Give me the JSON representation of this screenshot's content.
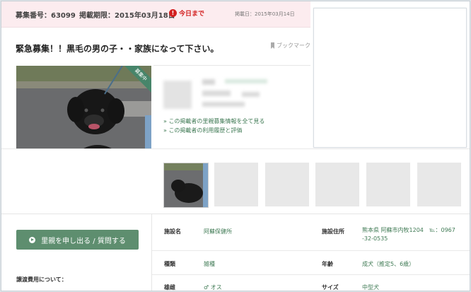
{
  "header": {
    "recruit_no_label": "募集番号：63099",
    "deadline_label": "掲載期限：2015年03月18日",
    "today_badge_icon": "alert-circle-icon",
    "today_badge": "今日まで",
    "posted_date": "掲載日：2015年03月14日"
  },
  "listing": {
    "title": "緊急募集！！黒毛の男の子・・家族になって下さい。",
    "bookmark_label": "ブックマーク",
    "photo_badge": "募集中"
  },
  "poster": {
    "links": [
      "この掲載者の里親募集情報を全て見る",
      "この掲載者の利用履歴と評価"
    ]
  },
  "actions": {
    "apply_button": "里親を申し出る / 質問する",
    "fee_label": "譲渡費用について："
  },
  "details": {
    "facility_name_label": "施設名",
    "facility_name": "阿蘇保健所",
    "facility_address_label": "施設住所",
    "facility_address_line1": "熊本県 阿蘇市内牧1204　℡：0967",
    "facility_address_line2": "-32-0535",
    "kind_label": "種類",
    "kind_value": "雑種",
    "age_label": "年齢",
    "age_value": "成犬（推定5、6歳）",
    "sex_label": "雄雌",
    "sex_icon": "male-icon",
    "sex_value": "♂ オス",
    "size_label": "サイズ",
    "size_value": "中型犬"
  },
  "colors": {
    "accent_green": "#5e8e6f",
    "link_green": "#3f7a54",
    "alert_red": "#d32020",
    "header_pink": "#fcecef"
  }
}
